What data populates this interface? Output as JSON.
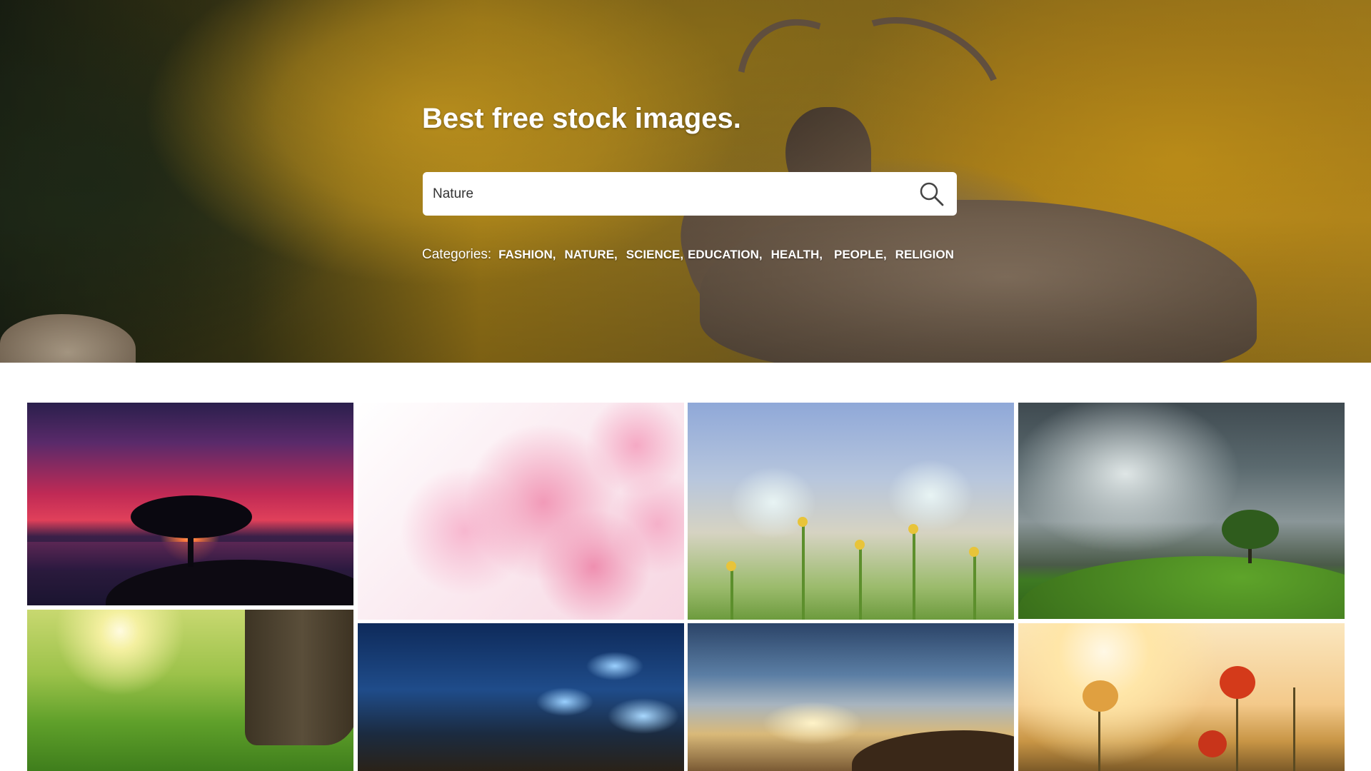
{
  "hero": {
    "title": "Best free stock images.",
    "search": {
      "value": "Nature",
      "placeholder": "",
      "icon": "search-icon"
    },
    "categories_label": "Categories:",
    "categories": [
      "FASHION,",
      "NATURE,",
      "SCIENCE,",
      "EDUCATION,",
      "HEALTH,",
      "PEOPLE,",
      "RELIGION"
    ]
  },
  "gallery": {
    "images": [
      "sunset tree by the sea",
      "pink cherry blossoms",
      "butterflies on flowers",
      "tree on green hill under storm clouds",
      "sunlit meadow with tree trunk",
      "glowing blue butterflies in forest",
      "sunrise above clouds",
      "red poppies at sunset"
    ]
  }
}
